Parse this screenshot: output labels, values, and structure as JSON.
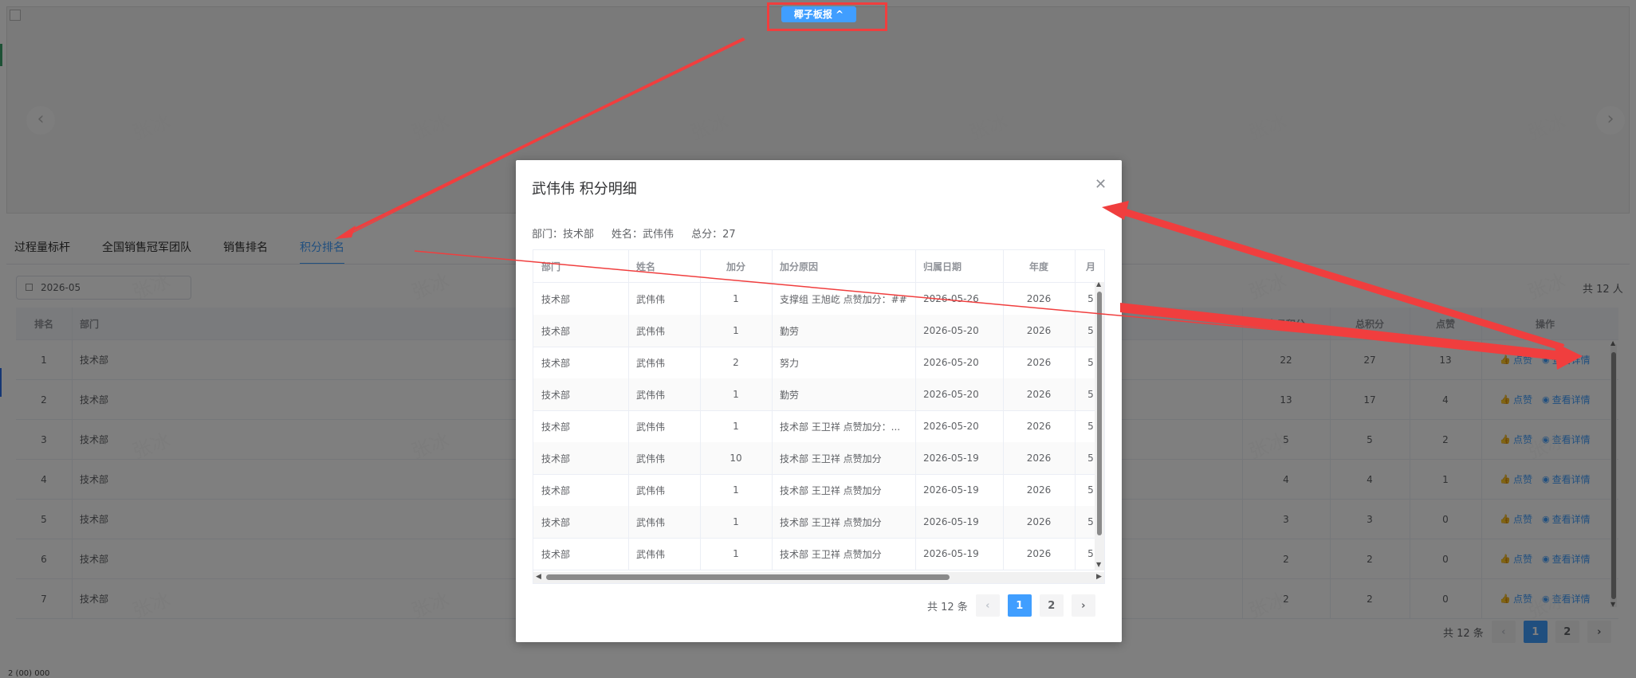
{
  "toggle_button": "椰子板报 ^",
  "tabs": [
    "过程量标杆",
    "全国销售冠军团队",
    "销售排名",
    "积分排名"
  ],
  "filter": {
    "month": "2026-05"
  },
  "summary": {
    "total_people": "共 12 人"
  },
  "rank_table": {
    "columns": [
      "排名",
      "部门",
      "本月积分",
      "总积分",
      "点赞",
      "操作"
    ],
    "rows": [
      {
        "rank": "1",
        "dept": "技术部",
        "month": "22",
        "total": "27",
        "likes": "13"
      },
      {
        "rank": "2",
        "dept": "技术部",
        "month": "13",
        "total": "17",
        "likes": "4"
      },
      {
        "rank": "3",
        "dept": "技术部",
        "month": "5",
        "total": "5",
        "likes": "2"
      },
      {
        "rank": "4",
        "dept": "技术部",
        "month": "4",
        "total": "4",
        "likes": "1"
      },
      {
        "rank": "5",
        "dept": "技术部",
        "month": "3",
        "total": "3",
        "likes": "0"
      },
      {
        "rank": "6",
        "dept": "技术部",
        "month": "2",
        "total": "2",
        "likes": "0"
      },
      {
        "rank": "7",
        "dept": "技术部",
        "month": "2",
        "total": "2",
        "likes": "0"
      }
    ],
    "like_label": "点赞",
    "detail_label": "查看详情"
  },
  "main_pager": {
    "total": "共 12 条",
    "pages": [
      "1",
      "2"
    ]
  },
  "watermark": "张冰",
  "bottom_text": "2 (00) 000",
  "dialog": {
    "title": "武伟伟 积分明细",
    "info": [
      {
        "label": "部门：",
        "value": "技术部"
      },
      {
        "label": "姓名：",
        "value": "武伟伟"
      },
      {
        "label": "总分：",
        "value": "27"
      }
    ],
    "columns": [
      "部门",
      "姓名",
      "加分",
      "加分原因",
      "归属日期",
      "年度",
      "月"
    ],
    "rows": [
      {
        "dept": "技术部",
        "name": "武伟伟",
        "points": "1",
        "reason": "支撑组 王旭屹 点赞加分：##",
        "date": "2026-05-26",
        "year": "2026",
        "month": "5"
      },
      {
        "dept": "技术部",
        "name": "武伟伟",
        "points": "1",
        "reason": "勤劳",
        "date": "2026-05-20",
        "year": "2026",
        "month": "5"
      },
      {
        "dept": "技术部",
        "name": "武伟伟",
        "points": "2",
        "reason": "努力",
        "date": "2026-05-20",
        "year": "2026",
        "month": "5"
      },
      {
        "dept": "技术部",
        "name": "武伟伟",
        "points": "1",
        "reason": "勤劳",
        "date": "2026-05-20",
        "year": "2026",
        "month": "5"
      },
      {
        "dept": "技术部",
        "name": "武伟伟",
        "points": "1",
        "reason": "技术部 王卫祥 点赞加分：...",
        "date": "2026-05-20",
        "year": "2026",
        "month": "5"
      },
      {
        "dept": "技术部",
        "name": "武伟伟",
        "points": "10",
        "reason": "技术部 王卫祥 点赞加分",
        "date": "2026-05-19",
        "year": "2026",
        "month": "5"
      },
      {
        "dept": "技术部",
        "name": "武伟伟",
        "points": "1",
        "reason": "技术部 王卫祥 点赞加分",
        "date": "2026-05-19",
        "year": "2026",
        "month": "5"
      },
      {
        "dept": "技术部",
        "name": "武伟伟",
        "points": "1",
        "reason": "技术部 王卫祥 点赞加分",
        "date": "2026-05-19",
        "year": "2026",
        "month": "5"
      },
      {
        "dept": "技术部",
        "name": "武伟伟",
        "points": "1",
        "reason": "技术部 王卫祥 点赞加分",
        "date": "2026-05-19",
        "year": "2026",
        "month": "5"
      }
    ],
    "pager": {
      "total": "共 12 条",
      "pages": [
        "1",
        "2"
      ]
    }
  },
  "colors": {
    "primary": "#409eff",
    "annotation_red": "#f03e3e"
  },
  "icons": {
    "close": "close-icon",
    "like": "thumb-up-icon",
    "view": "eye-icon",
    "calendar": "calendar-icon"
  }
}
